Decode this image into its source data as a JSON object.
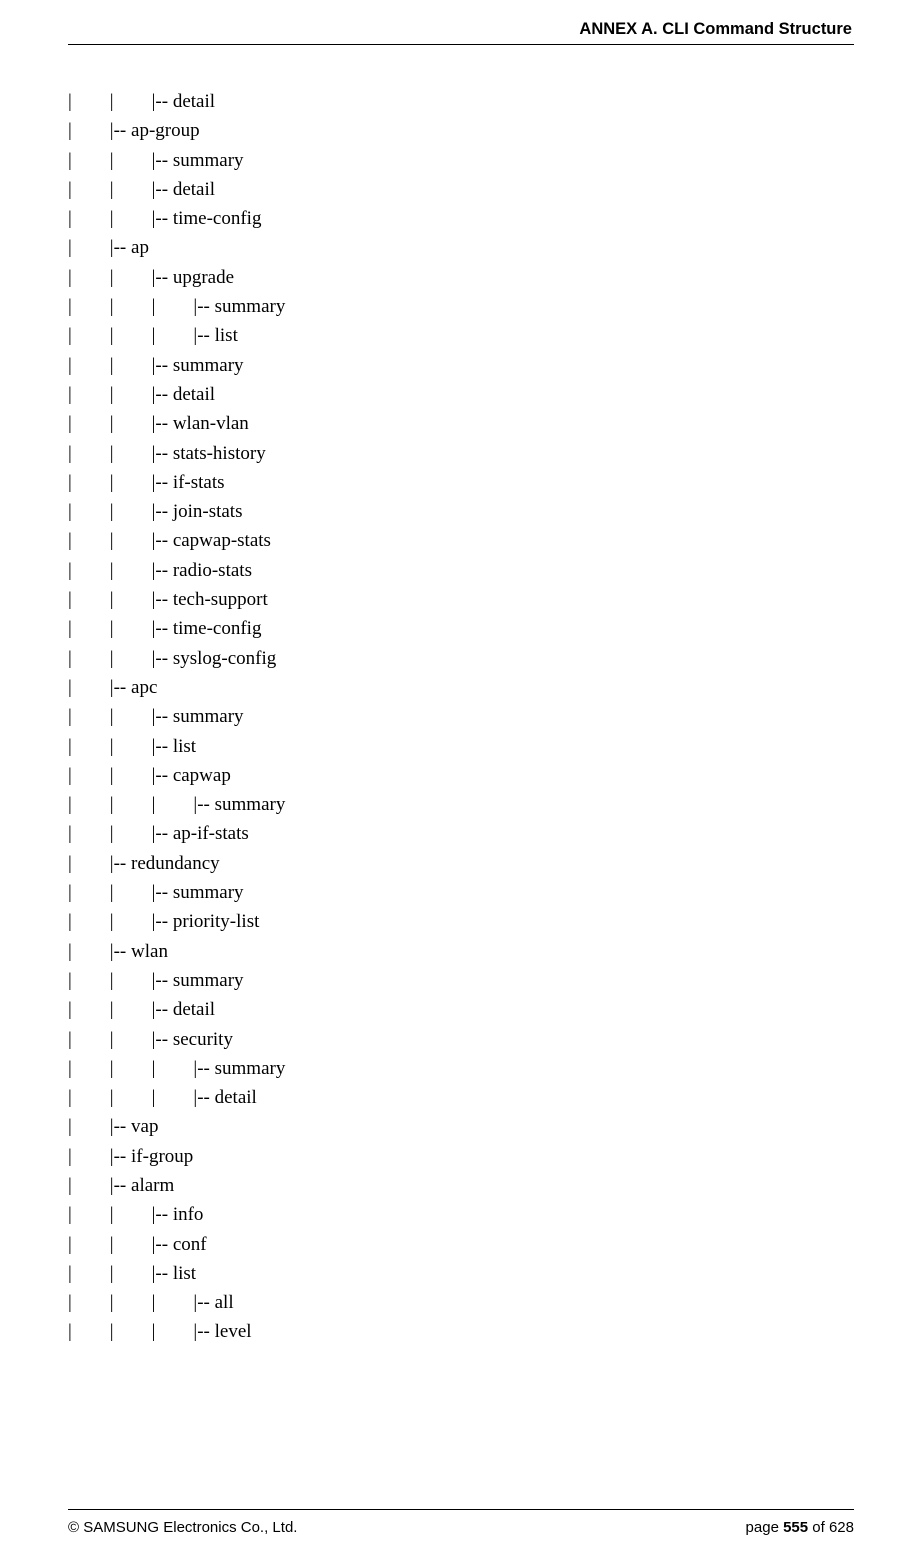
{
  "header": {
    "title": "ANNEX A. CLI Command Structure"
  },
  "tree": [
    "|        |        |-- detail",
    "|        |-- ap-group",
    "|        |        |-- summary",
    "|        |        |-- detail",
    "|        |        |-- time-config",
    "|        |-- ap",
    "|        |        |-- upgrade",
    "|        |        |        |-- summary",
    "|        |        |        |-- list",
    "|        |        |-- summary",
    "|        |        |-- detail",
    "|        |        |-- wlan-vlan",
    "|        |        |-- stats-history",
    "|        |        |-- if-stats",
    "|        |        |-- join-stats",
    "|        |        |-- capwap-stats",
    "|        |        |-- radio-stats",
    "|        |        |-- tech-support",
    "|        |        |-- time-config",
    "|        |        |-- syslog-config",
    "|        |-- apc",
    "|        |        |-- summary",
    "|        |        |-- list",
    "|        |        |-- capwap",
    "|        |        |        |-- summary",
    "|        |        |-- ap-if-stats",
    "|        |-- redundancy",
    "|        |        |-- summary",
    "|        |        |-- priority-list",
    "|        |-- wlan",
    "|        |        |-- summary",
    "|        |        |-- detail",
    "|        |        |-- security",
    "|        |        |        |-- summary",
    "|        |        |        |-- detail",
    "|        |-- vap",
    "|        |-- if-group",
    "|        |-- alarm",
    "|        |        |-- info",
    "|        |        |-- conf",
    "|        |        |-- list",
    "|        |        |        |-- all",
    "|        |        |        |-- level"
  ],
  "footer": {
    "copyright": "© SAMSUNG Electronics Co., Ltd.",
    "page_prefix": "page ",
    "page_current": "555",
    "page_suffix": " of 628"
  }
}
